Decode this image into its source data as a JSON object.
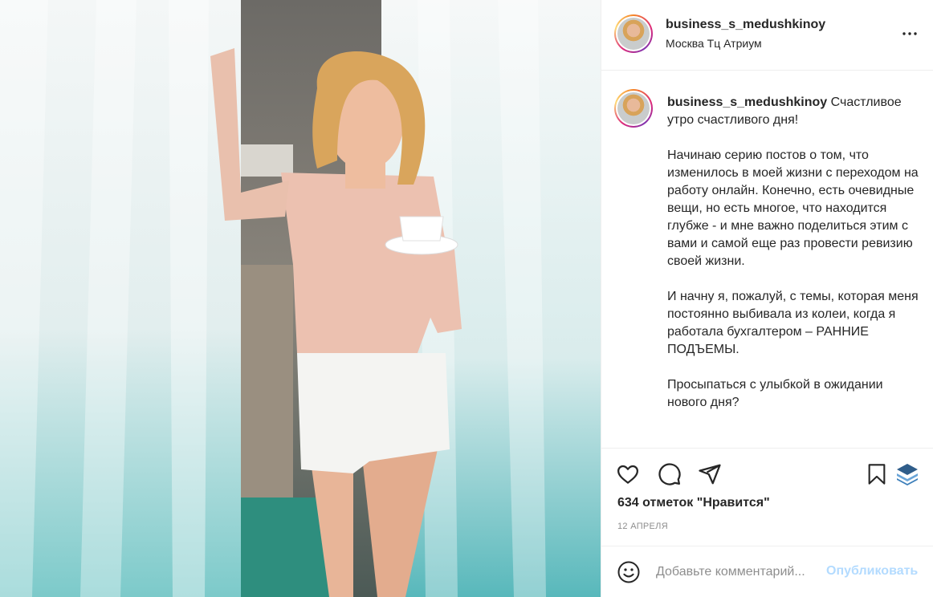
{
  "post": {
    "username": "business_s_medushkinoy",
    "location": "Москва Тц Атриум",
    "more_icon": "more-options-icon"
  },
  "caption": {
    "username": "business_s_medushkinoy",
    "first_line": " Счастливое утро счастливого дня!",
    "paragraphs": [
      "Начинаю серию постов о том, что изменилось в моей жизни с переходом на работу онлайн. Конечно, есть очевидные вещи, но есть многое, что находится глубже - и мне важно поделиться этим с вами и самой еще раз провести ревизию своей жизни.",
      "И начну я, пожалуй, с темы, которая меня постоянно выбивала из колеи, когда я работала бухгалтером – РАННИЕ ПОДЪЕМЫ.",
      "Просыпаться с улыбкой в ожидании нового дня?"
    ]
  },
  "actions": {
    "like_icon": "heart-icon",
    "comment_icon": "comment-icon",
    "share_icon": "share-icon",
    "save_icon": "bookmark-icon",
    "extra_icon": "layers-icon"
  },
  "likes_text": "634 отметок \"Нравится\"",
  "date_text": "12 АПРЕЛЯ",
  "comment_box": {
    "placeholder": "Добавьте комментарий...",
    "publish_label": "Опубликовать",
    "publish_color": "#b3dbff"
  },
  "photo": {
    "description_icon": "post-photo"
  }
}
